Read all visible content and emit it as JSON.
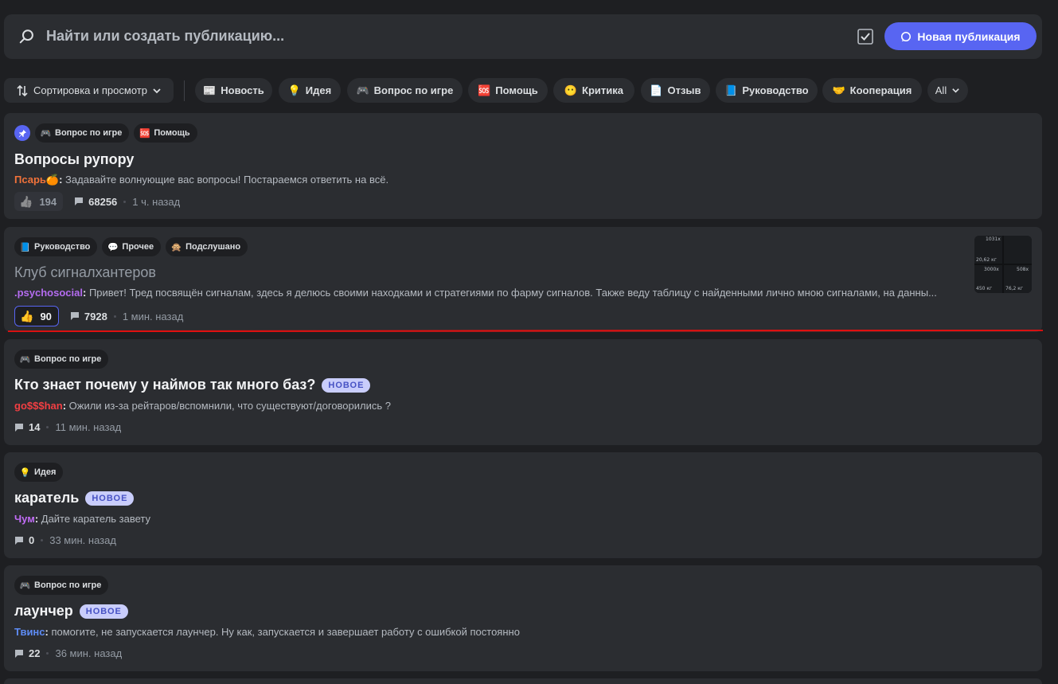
{
  "search": {
    "placeholder": "Найти или создать публикацию..."
  },
  "new_post_button": "Новая публикация",
  "filters": {
    "sort_label": "Сортировка и просмотр",
    "chips": [
      {
        "emoji": "📰",
        "label": "Новость"
      },
      {
        "emoji": "💡",
        "label": "Идея"
      },
      {
        "emoji": "🎮",
        "label": "Вопрос по игре"
      },
      {
        "emoji": "🆘",
        "label": "Помощь"
      },
      {
        "emoji": "😶",
        "label": "Критика"
      },
      {
        "emoji": "📄",
        "label": "Отзыв"
      },
      {
        "emoji": "📘",
        "label": "Руководство"
      },
      {
        "emoji": "🤝",
        "label": "Кооперация"
      }
    ],
    "all_label": "All"
  },
  "posts": [
    {
      "tags": [
        {
          "emoji": "🎮",
          "label": "Вопрос по игре"
        },
        {
          "emoji": "🆘",
          "label": "Помощь"
        }
      ],
      "title": "Вопросы рупору",
      "author": "Псарь",
      "author_emoji": "🍊",
      "text": "Задавайте волнующие вас вопросы! Постараемся ответить на всё.",
      "likes": "194",
      "comments": "68256",
      "time": "1 ч. назад"
    },
    {
      "tags": [
        {
          "emoji": "📘",
          "label": "Руководство"
        },
        {
          "emoji": "💬",
          "label": "Прочее"
        },
        {
          "emoji": "🙊",
          "label": "Подслушано"
        }
      ],
      "title": "Клуб сигналхантеров",
      "author": ".psychosocial",
      "text": "Привет! Тред посвящён сигналам, здесь я делюсь своими находками и стратегиями по фарму сигналов. Также веду таблицу с найденными лично мною сигналами, на данны...",
      "likes": "90",
      "comments": "7928",
      "time": "1 мин. назад",
      "thumb_labels": [
        "1031x",
        "20,62 кг",
        "3000x",
        "508x",
        "450 кг",
        "76,2 кг"
      ]
    },
    {
      "tags": [
        {
          "emoji": "🎮",
          "label": "Вопрос по игре"
        }
      ],
      "title": "Кто знает почему у наймов так много баз?",
      "badge": "НОВОЕ",
      "author": "go$$$han",
      "text": "Ожили из-за рейтаров/вспомнили, что существуют/договорились ?",
      "comments": "14",
      "time": "11 мин. назад"
    },
    {
      "tags": [
        {
          "emoji": "💡",
          "label": "Идея"
        }
      ],
      "title": "каратель",
      "badge": "НОВОЕ",
      "author": "Чум",
      "text": "Дайте каратель завету",
      "comments": "0",
      "time": "33 мин. назад"
    },
    {
      "tags": [
        {
          "emoji": "🎮",
          "label": "Вопрос по игре"
        }
      ],
      "title": "лаунчер",
      "badge": "НОВОЕ",
      "author": "Твинс",
      "text": "помогите, не запускается лаунчер. Ну как, запускается и завершает работу с ошибкой постоянно",
      "comments": "22",
      "time": "36 мин. назад"
    }
  ],
  "colors": {
    "accent": "#5865f2",
    "author_psar": "#f0723a",
    "author_psychosocial": "#b46cf0",
    "author_goshan": "#f23f43",
    "author_chum": "#c06cf5",
    "author_twins": "#5e8cf5",
    "annotation_line": "#e01010"
  }
}
